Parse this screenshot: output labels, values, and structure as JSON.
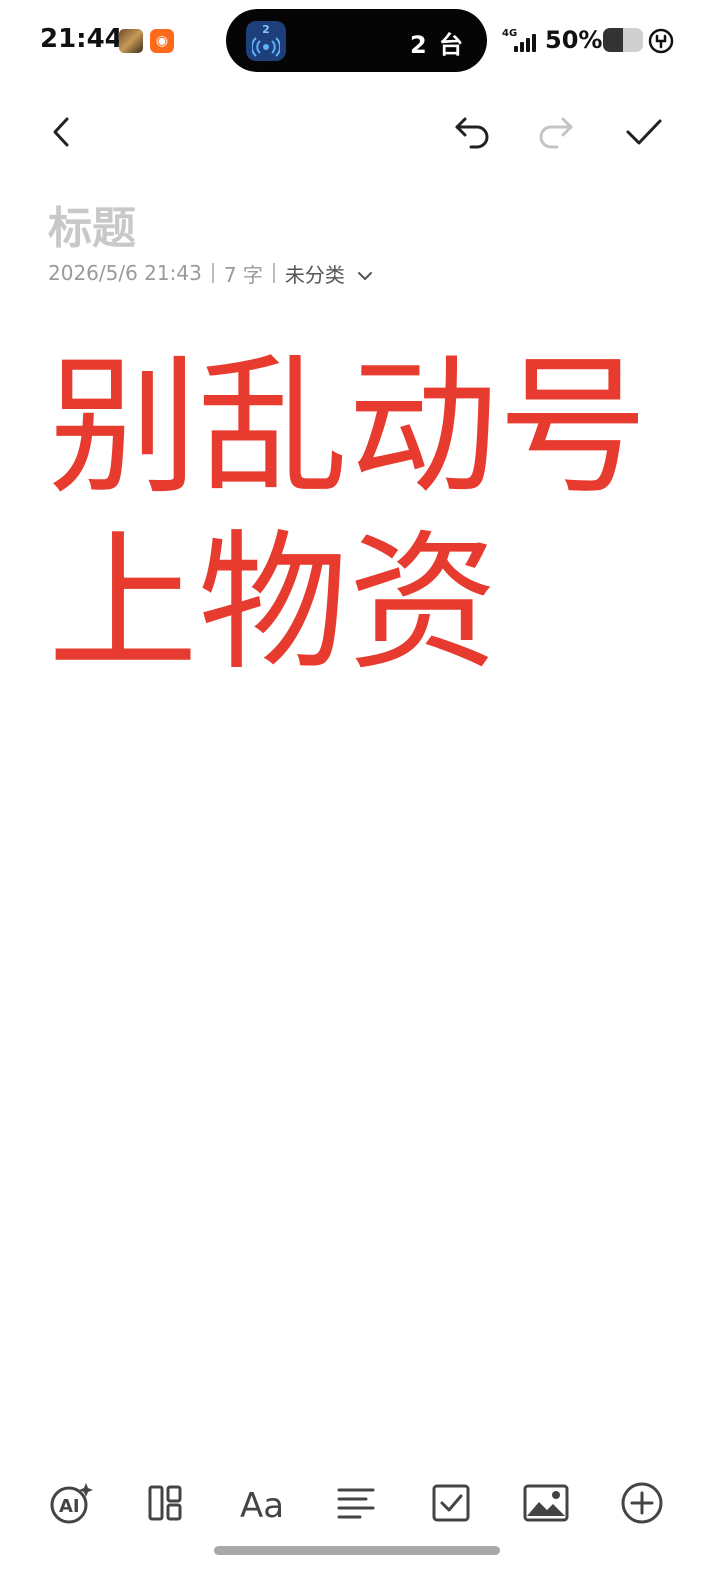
{
  "status_bar": {
    "time": "21:44",
    "island_text": "2 台",
    "island_badge": "2",
    "network": "4G",
    "battery": "50%",
    "battery_level": 0.5
  },
  "toolbar": {
    "back_icon": "chevron-left-icon",
    "undo_icon": "undo-icon",
    "redo_icon": "redo-icon",
    "done_icon": "checkmark-icon"
  },
  "note": {
    "title_placeholder": "标题",
    "date": "2026/5/6 21:43",
    "word_count": "7 字",
    "category": "未分类",
    "lines": [
      "别乱动号",
      "上物资"
    ],
    "text_color": "#e63b2e"
  },
  "bottom_toolbar": {
    "items": [
      "ai-assistant-icon",
      "layout-icon",
      "text-format-icon",
      "align-icon",
      "checklist-icon",
      "image-icon",
      "add-icon"
    ]
  }
}
